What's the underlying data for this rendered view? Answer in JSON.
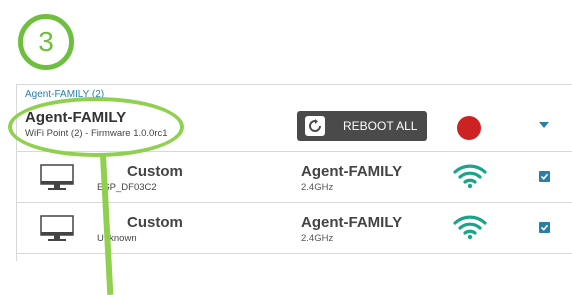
{
  "step": {
    "number": "3"
  },
  "breadcrumb": "Agent-FAMILY (2)",
  "header": {
    "title": "Agent-FAMILY",
    "subtitle": "WiFi Point (2) - Firmware 1.0.0rc1",
    "reboot_label": "REBOOT ALL",
    "status_color": "#cc2222"
  },
  "devices": [
    {
      "name": "Custom",
      "sub": "ESP_DF03C2",
      "ssid": "Agent-FAMILY",
      "band": "2.4GHz",
      "signal_icon": "wifi-icon",
      "checked": true
    },
    {
      "name": "Custom",
      "sub": "Unknown",
      "ssid": "Agent-FAMILY",
      "band": "2.4GHz",
      "signal_icon": "wifi-icon",
      "checked": true
    }
  ],
  "colors": {
    "accent": "#2a7fa8",
    "wifi": "#1aa58a",
    "annotation": "#8fd14f",
    "step": "#6fbf3f"
  }
}
